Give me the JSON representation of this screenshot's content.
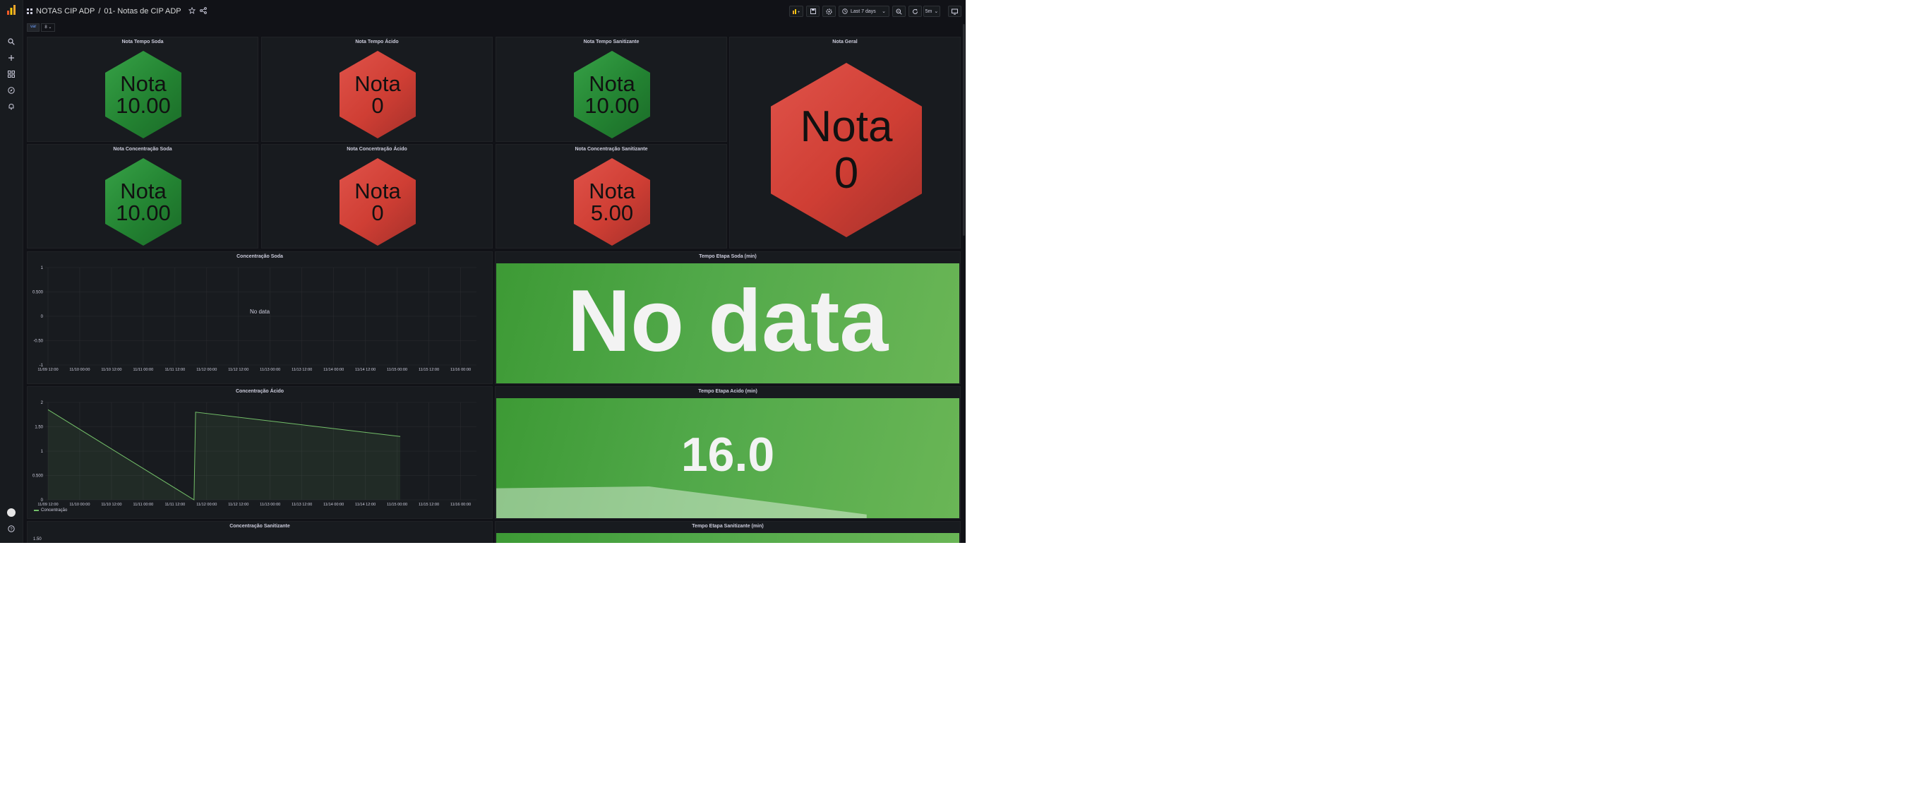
{
  "topbar": {
    "breadcrumb_folder": "NOTAS CIP ADP",
    "breadcrumb_sep": "/",
    "breadcrumb_dashboard": "01- Notas de CIP ADP",
    "time_range": "Last 7 days",
    "refresh_interval": "5m"
  },
  "variables": {
    "label": "var",
    "value": "8"
  },
  "notes": {
    "prefix": "Nota",
    "tempo_soda": {
      "title": "Nota Tempo Soda",
      "value": "10.00",
      "status": "green"
    },
    "tempo_acido": {
      "title": "Nota Tempo Ácido",
      "value": "0",
      "status": "red"
    },
    "tempo_sanitizante": {
      "title": "Nota Tempo Sanitizante",
      "value": "10.00",
      "status": "green"
    },
    "geral": {
      "title": "Nota Geral",
      "value": "0",
      "status": "red"
    },
    "conc_soda": {
      "title": "Nota Concentração Soda",
      "value": "10.00",
      "status": "green"
    },
    "conc_acido": {
      "title": "Nota Concentração Ácido",
      "value": "0",
      "status": "red"
    },
    "conc_sanitizante": {
      "title": "Nota Concentração Sanitizante",
      "value": "5.00",
      "status": "red"
    }
  },
  "colors": {
    "green": "#37a247",
    "red": "#e0534a",
    "stat_green": "#52a94a"
  },
  "panels": {
    "conc_soda_chart": {
      "title": "Concentração Soda",
      "no_data": "No data"
    },
    "tempo_soda_stat": {
      "title": "Tempo Etapa Soda (min)",
      "value": "No data"
    },
    "conc_acido_chart": {
      "title": "Concentração Ácido",
      "legend": "Concentração"
    },
    "tempo_acido_stat": {
      "title": "Tempo Etapa Acido (min)",
      "value": "16.0"
    },
    "conc_sanitizante_chart": {
      "title": "Concentração Sanitizante",
      "first_tick": "1.50"
    },
    "tempo_sanitizante_stat": {
      "title": "Tempo Etapa Sanitizante (min)"
    }
  },
  "chart_data": [
    {
      "type": "line",
      "title": "Concentração Soda",
      "x_ticks": [
        "11/09 12:00",
        "11/10 00:00",
        "11/10 12:00",
        "11/11 00:00",
        "11/11 12:00",
        "11/12 00:00",
        "11/12 12:00",
        "11/13 00:00",
        "11/13 12:00",
        "11/14 00:00",
        "11/14 12:00",
        "11/15 00:00",
        "11/15 12:00",
        "11/16 00:00"
      ],
      "y_ticks": [
        "1",
        "0.500",
        "0",
        "-0.50",
        "-1"
      ],
      "ylim": [
        -1,
        1
      ],
      "series": []
    },
    {
      "type": "area",
      "title": "Concentração Ácido",
      "x_ticks": [
        "11/09 12:00",
        "11/10 00:00",
        "11/10 12:00",
        "11/11 00:00",
        "11/11 12:00",
        "11/12 00:00",
        "11/12 12:00",
        "11/13 00:00",
        "11/13 12:00",
        "11/14 00:00",
        "11/14 12:00",
        "11/15 00:00",
        "11/15 12:00",
        "11/16 00:00"
      ],
      "y_ticks": [
        "2",
        "1.50",
        "1",
        "0.500",
        "0"
      ],
      "ylim": [
        0,
        2
      ],
      "x_index_range": [
        0,
        13.5
      ],
      "series": [
        {
          "name": "Concentração",
          "x_index": [
            0,
            4.6,
            4.65,
            11.1
          ],
          "y": [
            1.85,
            0,
            1.8,
            1.3
          ]
        }
      ]
    },
    {
      "type": "area",
      "title": "Tempo Etapa Acido (min) sparkline",
      "series": [
        {
          "x": [
            0,
            0.33,
            0.8
          ],
          "y": [
            0.8,
            0.85,
            0.1
          ]
        }
      ],
      "ylim": [
        0,
        1
      ]
    }
  ]
}
